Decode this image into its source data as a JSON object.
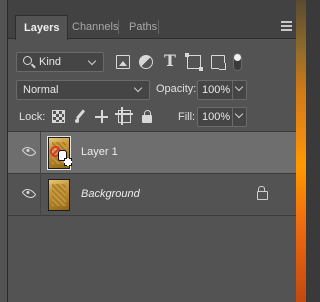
{
  "tabs": [
    {
      "label": "Layers",
      "active": true
    },
    {
      "label": "Channels",
      "active": false
    },
    {
      "label": "Paths",
      "active": false
    }
  ],
  "filter": {
    "kind_label": "Kind",
    "icons": [
      "image-filter-icon",
      "adjustment-filter-icon",
      "type-filter-icon",
      "shape-filter-icon",
      "smart-object-filter-icon"
    ]
  },
  "blend": {
    "mode": "Normal",
    "opacity_label": "Opacity:",
    "opacity_value": "100%"
  },
  "lock": {
    "label": "Lock:",
    "fill_label": "Fill:",
    "fill_value": "100%"
  },
  "layers": [
    {
      "name": "Layer 1",
      "selected": true,
      "visible": true,
      "locked": false
    },
    {
      "name": "Background",
      "selected": false,
      "visible": true,
      "locked": true
    }
  ],
  "colors": {
    "panel_bg": "#535353",
    "tabbar_bg": "#424242",
    "selected_layer_bg": "#6e6e6e",
    "field_bg": "#454545",
    "text": "#e6e6e6"
  }
}
